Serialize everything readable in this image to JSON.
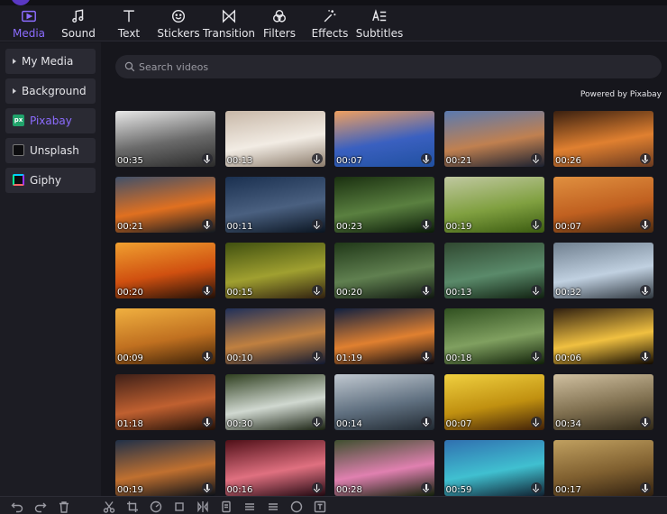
{
  "toolbar": {
    "tabs": [
      {
        "label": "Media",
        "icon": "media-icon",
        "active": true
      },
      {
        "label": "Sound",
        "icon": "music-note-icon"
      },
      {
        "label": "Text",
        "icon": "text-t-icon"
      },
      {
        "label": "Stickers",
        "icon": "smiley-icon"
      },
      {
        "label": "Transition",
        "icon": "bowtie-icon"
      },
      {
        "label": "Filters",
        "icon": "circles-icon"
      },
      {
        "label": "Effects",
        "icon": "magic-wand-icon"
      },
      {
        "label": "Subtitles",
        "icon": "subtitle-icon"
      }
    ],
    "accent": "#8c6cff"
  },
  "sidebar": {
    "items": [
      {
        "label": "My Media"
      },
      {
        "label": "Background"
      },
      {
        "label": "Pixabay",
        "active": true
      },
      {
        "label": "Unsplash"
      },
      {
        "label": "Giphy"
      }
    ]
  },
  "search": {
    "placeholder": "Search videos",
    "value": ""
  },
  "powered_by": "Powered by Pixabay",
  "videos": [
    {
      "duration": "00:35",
      "colors": [
        "#e8e8e8",
        "#6a6a6a",
        "#2a2a2a"
      ]
    },
    {
      "duration": "00:13",
      "colors": [
        "#c8b8a8",
        "#f2ece4",
        "#8a7a6a"
      ]
    },
    {
      "duration": "00:07",
      "colors": [
        "#f0a060",
        "#3a60c0",
        "#2050a0"
      ]
    },
    {
      "duration": "00:21",
      "colors": [
        "#5a7ab0",
        "#c08050",
        "#1a2030"
      ]
    },
    {
      "duration": "00:26",
      "colors": [
        "#3a2010",
        "#e08030",
        "#6a3a20"
      ]
    },
    {
      "duration": "00:21",
      "colors": [
        "#40506a",
        "#e07020",
        "#101820"
      ]
    },
    {
      "duration": "00:11",
      "colors": [
        "#1a3050",
        "#4a6080",
        "#0a1420"
      ]
    },
    {
      "duration": "00:23",
      "colors": [
        "#1a3010",
        "#5a8040",
        "#0a1a08"
      ]
    },
    {
      "duration": "00:19",
      "colors": [
        "#c0c8a0",
        "#80a040",
        "#3a5a10"
      ]
    },
    {
      "duration": "00:07",
      "colors": [
        "#e09040",
        "#c06020",
        "#4a2a10"
      ]
    },
    {
      "duration": "00:20",
      "colors": [
        "#f0a030",
        "#d05010",
        "#201008"
      ]
    },
    {
      "duration": "00:15",
      "colors": [
        "#405010",
        "#a0a030",
        "#302010"
      ]
    },
    {
      "duration": "00:20",
      "colors": [
        "#203818",
        "#608050",
        "#101810"
      ]
    },
    {
      "duration": "00:13",
      "colors": [
        "#304830",
        "#5a8a6a",
        "#102010"
      ]
    },
    {
      "duration": "00:32",
      "colors": [
        "#708090",
        "#c0d0e0",
        "#303840"
      ]
    },
    {
      "duration": "00:09",
      "colors": [
        "#f0b040",
        "#c07020",
        "#3a2008"
      ]
    },
    {
      "duration": "00:10",
      "colors": [
        "#20305a",
        "#c08040",
        "#101830"
      ]
    },
    {
      "duration": "01:19",
      "colors": [
        "#102040",
        "#e08030",
        "#080810"
      ]
    },
    {
      "duration": "00:18",
      "colors": [
        "#305020",
        "#80a060",
        "#102008"
      ]
    },
    {
      "duration": "00:06",
      "colors": [
        "#302010",
        "#f0c040",
        "#100800"
      ]
    },
    {
      "duration": "01:18",
      "colors": [
        "#402018",
        "#c06030",
        "#201008"
      ]
    },
    {
      "duration": "00:30",
      "colors": [
        "#304020",
        "#d0d8d0",
        "#182010"
      ]
    },
    {
      "duration": "00:14",
      "colors": [
        "#c0c8d0",
        "#607080",
        "#202830"
      ]
    },
    {
      "duration": "00:07",
      "colors": [
        "#f0d040",
        "#c09010",
        "#402008"
      ]
    },
    {
      "duration": "00:34",
      "colors": [
        "#d0c0a0",
        "#807050",
        "#302818"
      ]
    },
    {
      "duration": "00:19",
      "colors": [
        "#203048",
        "#c07030",
        "#0a1018"
      ]
    },
    {
      "duration": "00:16",
      "colors": [
        "#501018",
        "#e07080",
        "#200810"
      ]
    },
    {
      "duration": "00:28",
      "colors": [
        "#405030",
        "#e080b0",
        "#102008"
      ]
    },
    {
      "duration": "00:59",
      "colors": [
        "#3070b0",
        "#40c0d0",
        "#102030"
      ]
    },
    {
      "duration": "00:17",
      "colors": [
        "#c0a060",
        "#806030",
        "#302010"
      ]
    }
  ]
}
